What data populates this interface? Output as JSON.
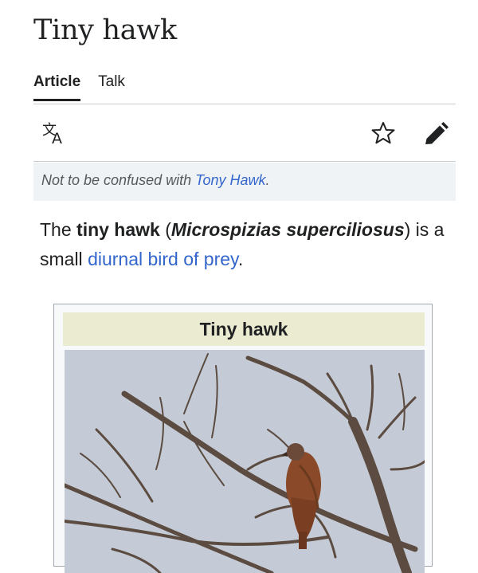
{
  "page": {
    "title": "Tiny hawk"
  },
  "tabs": [
    {
      "label": "Article",
      "active": true
    },
    {
      "label": "Talk",
      "active": false
    }
  ],
  "toolbar": {
    "language_icon": "translate-icon",
    "watch_icon": "star-icon",
    "edit_icon": "pencil-icon"
  },
  "hatnote": {
    "prefix": "Not to be confused with ",
    "link": "Tony Hawk",
    "suffix": "."
  },
  "lead": {
    "the": "The ",
    "bold_name": "tiny hawk",
    "open_paren": " (",
    "scientific_name": "Microspizias superciliosus",
    "close_paren": ")",
    "is_a": " is a small ",
    "link": "diurnal bird of prey",
    "end": "."
  },
  "infobox": {
    "title": "Tiny hawk",
    "image_alt": "photo of a tiny hawk perched on bare branches"
  },
  "colors": {
    "link": "#3366cc",
    "hatnote_bg": "#f0f3f6",
    "infobox_title_bg": "#ebebd2",
    "sky": "#c5ccd6"
  }
}
